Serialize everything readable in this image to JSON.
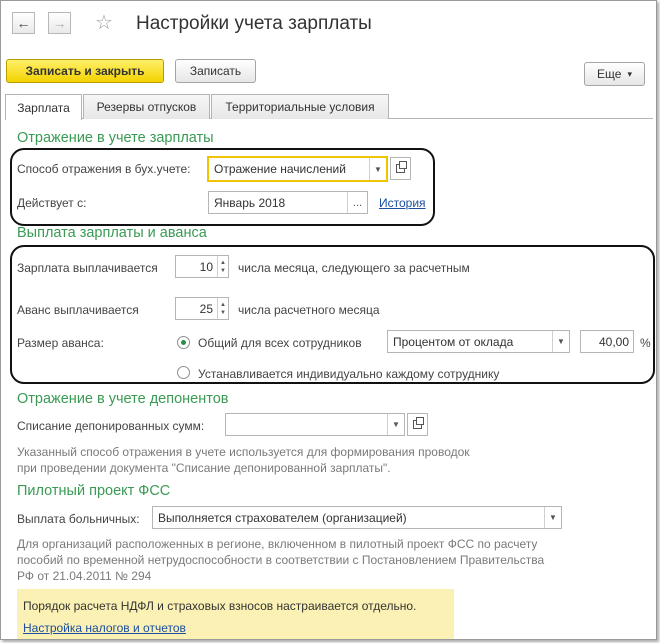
{
  "window": {
    "title": "Настройки учета зарплаты"
  },
  "toolbar": {
    "back_icon": "arrow-left-icon",
    "forward_icon": "arrow-right-icon",
    "favorite_icon": "star-icon",
    "save_close_label": "Записать и закрыть",
    "save_label": "Записать",
    "more_label": "Еще",
    "more_arrow": "▾"
  },
  "tabs": [
    {
      "label": "Зарплата"
    },
    {
      "label": "Резервы отпусков"
    },
    {
      "label": "Территориальные условия"
    }
  ],
  "accounting": {
    "section_title": "Отражение в учете зарплаты",
    "method_label": "Способ отражения в бух.учете:",
    "method_value": "Отражение начислений",
    "effective_label": "Действует с:",
    "effective_value": "Январь 2018",
    "effective_btn": "...",
    "history_link": "История"
  },
  "payment": {
    "section_title": "Выплата зарплаты и аванса",
    "salary_label": "Зарплата выплачивается",
    "salary_day": "10",
    "salary_suffix": "числа месяца, следующего за расчетным",
    "advance_label": "Аванс выплачивается",
    "advance_day": "25",
    "advance_suffix": "числа расчетного месяца",
    "advance_size_label": "Размер аванса:",
    "option_common": "Общий для всех сотрудников",
    "option_individual": "Устанавливается индивидуально каждому сотруднику",
    "method_value": "Процентом от оклада",
    "percent_value": "40,00",
    "percent_unit": "%"
  },
  "deponents": {
    "section_title": "Отражение в учете депонентов",
    "writeoff_label": "Списание депонированных сумм:",
    "writeoff_value": "",
    "note_line1": "Указанный способ отражения в учете используется для формирования проводок",
    "note_line2": "при проведении документа \"Списание депонированной зарплаты\"."
  },
  "fss": {
    "section_title": "Пилотный проект ФСС",
    "sick_label": "Выплата больничных:",
    "sick_value": "Выполняется страхователем (организацией)",
    "note_line1": "Для организаций расположенных в регионе, включенном в пилотный проект ФСС по расчету",
    "note_line2": "пособий по временной нетрудоспособности в соответствии с Постановлением Правительства",
    "note_line3": "РФ от 21.04.2011 № 294"
  },
  "banner": {
    "text": "Порядок расчета НДФЛ и страховых взносов настраивается отдельно.",
    "link": "Настройка налогов и отчетов"
  },
  "colors": {
    "accent_green": "#3a9a54",
    "primary_button": "#f3d300",
    "link_blue": "#1a4ea0",
    "banner_bg": "#fbf1b4"
  }
}
